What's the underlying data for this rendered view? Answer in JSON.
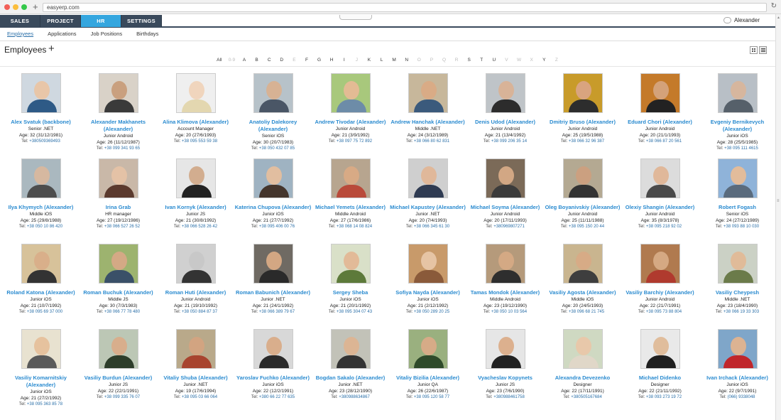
{
  "browser": {
    "url": "easyerp.com",
    "new_tab": "+"
  },
  "nav": {
    "tabs": [
      {
        "label": "SALES",
        "width": 57,
        "active": false
      },
      {
        "label": "PROJECT",
        "width": 57,
        "active": false
      },
      {
        "label": "HR",
        "width": 57,
        "active": true
      },
      {
        "label": "SETTINGS",
        "width": 57,
        "active": false
      }
    ],
    "user": "Alexander"
  },
  "subnav": [
    "Employees",
    "Applications",
    "Job Positions",
    "Birthdays"
  ],
  "page": {
    "title": "Employees",
    "add": "+"
  },
  "alphabet": [
    "All",
    "0-9",
    "A",
    "B",
    "C",
    "D",
    "E",
    "F",
    "G",
    "H",
    "I",
    "J",
    "K",
    "L",
    "M",
    "N",
    "O",
    "P",
    "Q",
    "R",
    "S",
    "T",
    "U",
    "V",
    "W",
    "X",
    "Y",
    "Z"
  ],
  "alphabet_dim": [
    "0-9",
    "E",
    "J",
    "O",
    "P",
    "Q",
    "R",
    "V",
    "W",
    "X",
    "Z"
  ],
  "employees": [
    {
      "name": "Alex Svatuk (backbone)",
      "role": "Senior .NET",
      "age": "Age: 32 (31/12/1981)",
      "tel": "+380509369493",
      "photo": [
        "#cfd8e0",
        "#e8c6a8",
        "#2e5a86"
      ]
    },
    {
      "name": "Alexander Makhanets (Alexander)",
      "role": "Junior Android",
      "age": "Age: 26 (11/12/1987)",
      "tel": "+38 099 341 93 65",
      "photo": [
        "#d9d2c8",
        "#c9a07f",
        "#3a3a3a"
      ]
    },
    {
      "name": "Alina Klimova (Alexander)",
      "role": "Account Manager",
      "age": "Age: 20 (27/6/1993)",
      "tel": "+38 095 553 59 38",
      "photo": [
        "#efefef",
        "#f0d5bd",
        "#e3d7b0"
      ]
    },
    {
      "name": "Anatoliy Dalekorey (Alexander)",
      "role": "Senior iOS",
      "age": "Age: 30 (20/7/1983)",
      "tel": "+38 050 432 07 85",
      "photo": [
        "#b7c2c9",
        "#d7b294",
        "#4a5666"
      ]
    },
    {
      "name": "Andrew Tivodar (Alexander)",
      "role": "Junior Android",
      "age": "Age: 21 (3/9/1992)",
      "tel": "+38 097 75 72 892",
      "photo": [
        "#a8c87c",
        "#e3bb94",
        "#6d8ca8"
      ]
    },
    {
      "name": "Andrew Hanchak (Alexander)",
      "role": "Middle .NET",
      "age": "Age: 24 (3/12/1989)",
      "tel": "+38 066 80 62 831",
      "photo": [
        "#c7b79b",
        "#d9ab86",
        "#3b5a7c"
      ]
    },
    {
      "name": "Denis Udod (Alexander)",
      "role": "Junior Android",
      "age": "Age: 21 (13/4/1992)",
      "tel": "+38 099 206 35 14",
      "photo": [
        "#bfc4c8",
        "#d8b398",
        "#2c2c2c"
      ]
    },
    {
      "name": "Dmitriy Bruso (Alexander)",
      "role": "Junior Android",
      "age": "Age: 25 (19/5/1988)",
      "tel": "+38 066 32 96 387",
      "photo": [
        "#c89b2a",
        "#d9a47f",
        "#2d2d2d"
      ]
    },
    {
      "name": "Eduard Chori (Alexander)",
      "role": "Junior Android",
      "age": "Age: 20 (21/1/1993)",
      "tel": "+38 066 87 20 561",
      "photo": [
        "#c47a2a",
        "#d4a27a",
        "#222222"
      ]
    },
    {
      "name": "Evgeniy Bernikevych (Alexander)",
      "role": "Junior iOS",
      "age": "Age: 28 (25/5/1985)",
      "tel": "+38 095 111 4615",
      "photo": [
        "#b8bfc6",
        "#d6b69e",
        "#56606a"
      ]
    },
    {
      "name": "Ilya Khymych (Alexander)",
      "role": "Middle iOS",
      "age": "Age: 25 (29/8/1988)",
      "tel": "+38 050 10 86 420",
      "photo": [
        "#aab8bf",
        "#d6b8a0",
        "#4d4d4d"
      ]
    },
    {
      "name": "Irina Grab",
      "role": "HR manager",
      "age": "Age: 27 (19/12/1986)",
      "tel": "+38 066 527 26 52",
      "photo": [
        "#c9b8a8",
        "#e4c2a6",
        "#5b3a2e"
      ]
    },
    {
      "name": "Ivan Kornyk (Alexander)",
      "role": "Junior JS",
      "age": "Age: 21 (30/8/1992)",
      "tel": "+38 066 528 26 42",
      "photo": [
        "#e6e6e6",
        "#d2ad8f",
        "#222222"
      ]
    },
    {
      "name": "Katerina Chupova (Alexander)",
      "role": "Junior iOS",
      "age": "Age: 21 (27/7/1992)",
      "tel": "+38 095 406 00 76",
      "photo": [
        "#9fb3c2",
        "#e1bea0",
        "#44352c"
      ]
    },
    {
      "name": "Michael Yemets (Alexander)",
      "role": "Middle Android",
      "age": "Age: 27 (17/6/1986)",
      "tel": "+38 068 14 08 824",
      "photo": [
        "#b7a58f",
        "#d8aa85",
        "#b94a3a"
      ]
    },
    {
      "name": "Michael Kapustey (Alexander)",
      "role": "Junior .NET",
      "age": "Age: 20 (7/4/1993)",
      "tel": "+38 066 345 61 30",
      "photo": [
        "#cfcfcf",
        "#e0b89a",
        "#2f3b52"
      ]
    },
    {
      "name": "Michael Soyma (Alexander)",
      "role": "Junior Android",
      "age": "Age: 20 (17/11/1993)",
      "tel": "+380969807271",
      "photo": [
        "#7b6a58",
        "#d2a784",
        "#3b3b3b"
      ]
    },
    {
      "name": "Oleg Boyanivskiy (Alexander)",
      "role": "Junior Android",
      "age": "Age: 25 (11/11/1988)",
      "tel": "+38 095 150 20 44",
      "photo": [
        "#b4a992",
        "#cba080",
        "#333333"
      ]
    },
    {
      "name": "Olexiy Shangin (Alexander)",
      "role": "Junior Android",
      "age": "Age: 35 (8/3/1978)",
      "tel": "+38 095 218 92 02",
      "photo": [
        "#dcdcdc",
        "#e0b89a",
        "#4a4a4a"
      ]
    },
    {
      "name": "Robert Fogash",
      "role": "Senior iOS",
      "age": "Age: 24 (27/12/1989)",
      "tel": "+38 093 88 10 030",
      "photo": [
        "#8fb3d9",
        "#e2bc9b",
        "#5a6b7d"
      ]
    },
    {
      "name": "Roland Katona (Alexander)",
      "role": "Junior iOS",
      "age": "Age: 21 (10/7/1992)",
      "tel": "+38 095 69 37 000",
      "photo": [
        "#d7c29a",
        "#d9af8a",
        "#333333"
      ]
    },
    {
      "name": "Roman Buchuk (Alexander)",
      "role": "Middle JS",
      "age": "Age: 30 (7/3/1983)",
      "tel": "+38 066 77 78 480",
      "photo": [
        "#9db36f",
        "#d4a985",
        "#3a5068"
      ]
    },
    {
      "name": "Roman Huti (Alexander)",
      "role": "Junior Android",
      "age": "Age: 21 (19/10/1992)",
      "tel": "+38 050 884 87 37",
      "photo": [
        "#d0d0d0",
        "#c8c8c8",
        "#333333"
      ]
    },
    {
      "name": "Roman Babunich (Alexander)",
      "role": "Junior .NET",
      "age": "Age: 21 (24/1/1992)",
      "tel": "+38 066 389 79 67",
      "photo": [
        "#6f6a63",
        "#d3a783",
        "#2a2a2a"
      ]
    },
    {
      "name": "Sergey Sheba",
      "role": "Junior iOS",
      "age": "Age: 21 (20/1/1992)",
      "tel": "+38 095 304 07 43",
      "photo": [
        "#d9e0c8",
        "#e2ba98",
        "#5d7a3a"
      ]
    },
    {
      "name": "Sofiya Nayda (Alexander)",
      "role": "Junior iOS",
      "age": "Age: 21 (2/12/1992)",
      "tel": "+38 050 289 20 25",
      "photo": [
        "#c89a6a",
        "#e6c4a4",
        "#8a5a3a"
      ]
    },
    {
      "name": "Tamas Mondok (Alexander)",
      "role": "Middle Android",
      "age": "Age: 23 (19/12/1990)",
      "tel": "+38 050 10 03 564",
      "photo": [
        "#b59a7b",
        "#d4a984",
        "#2e2e2e"
      ]
    },
    {
      "name": "Vasiliy Agosta (Alexander)",
      "role": "Middle iOS",
      "age": "Age: 20 (24/5/1993)",
      "tel": "+38 096 68 21 745",
      "photo": [
        "#c9b58f",
        "#d7ab86",
        "#3e3e3e"
      ]
    },
    {
      "name": "Vasiliy Barchiy (Alexander)",
      "role": "Junior Android",
      "age": "Age: 22 (21/7/1991)",
      "tel": "+38 095 73 88 804",
      "photo": [
        "#b07a4f",
        "#d5a983",
        "#b03a2e"
      ]
    },
    {
      "name": "Vasiliy Cheypesh",
      "role": "Middle .NET",
      "age": "Age: 23 (18/4/1990)",
      "tel": "+38 066 19 33 303",
      "photo": [
        "#cbd1c5",
        "#e0bb99",
        "#6b7b4a"
      ]
    },
    {
      "name": "Vasiliy Komarnitskiy (Alexander)",
      "role": "Junior iOS",
      "age": "Age: 21 (27/2/1992)",
      "tel": "+38 095 363 85 78",
      "photo": [
        "#e8e2d0",
        "#e6c29e",
        "#5a5a5a"
      ]
    },
    {
      "name": "Vasiliy Burdun (Alexander)",
      "role": "Junior JS",
      "age": "Age: 22 (22/1/1991)",
      "tel": "+38 099 335 76 07",
      "photo": [
        "#bcc7b5",
        "#d8ae8c",
        "#2d3d2a"
      ]
    },
    {
      "name": "Vitaliy Shuba (Alexander)",
      "role": "Junior .NET",
      "age": "Age: 19 (17/6/1994)",
      "tel": "+38 095 03 66 064",
      "photo": [
        "#b9a98a",
        "#d2a481",
        "#a8442f"
      ]
    },
    {
      "name": "Yaroslav Fuchko (Alexander)",
      "role": "Junior iOS",
      "age": "Age: 22 (12/2/1991)",
      "tel": "+380 66 22 77 635",
      "photo": [
        "#d8d8d8",
        "#d9ae8c",
        "#2a2a2a"
      ]
    },
    {
      "name": "Bogdan Sakalo (Alexander)",
      "role": "Junior .NET",
      "age": "Age: 23 (28/12/1990)",
      "tel": "+380988634867",
      "photo": [
        "#c2c2b8",
        "#dcb594",
        "#333333"
      ]
    },
    {
      "name": "Vitaliy Bizilia (Alexander)",
      "role": "Junior QA",
      "age": "Age: 26 (22/6/1987)",
      "tel": "+38 095 120 58 77",
      "photo": [
        "#9ab07f",
        "#d6ab87",
        "#2f4a2a"
      ]
    },
    {
      "name": "Vyacheslav Kopynets",
      "role": "Junior JS",
      "age": "Age: 23 (7/6/1990)",
      "tel": "+380988461758",
      "photo": [
        "#e6e6e6",
        "#dcb08e",
        "#222222"
      ]
    },
    {
      "name": "Alexandra Devezenko",
      "role": "Designer",
      "age": "Age: 22 (17/11/1991)",
      "tel": "+380505167684",
      "photo": [
        "#cfd9c2",
        "#e8c8aa",
        "#e0d7c8"
      ]
    },
    {
      "name": "Michael Didenko",
      "role": "Designer",
      "age": "Age: 22 (21/11/1992)",
      "tel": "+38 093 273 19 72",
      "photo": [
        "#e9e9e9",
        "#e0bd9c",
        "#1f1f1f"
      ]
    },
    {
      "name": "Ivan Irchack (Alexander)",
      "role": "Junior iOS",
      "age": "Age: 22 (9/7/1991)",
      "tel": "(066) 9338048",
      "photo": [
        "#7fa6c9",
        "#dcb392",
        "#c0262b"
      ]
    }
  ],
  "tel_prefix": "Tel:"
}
